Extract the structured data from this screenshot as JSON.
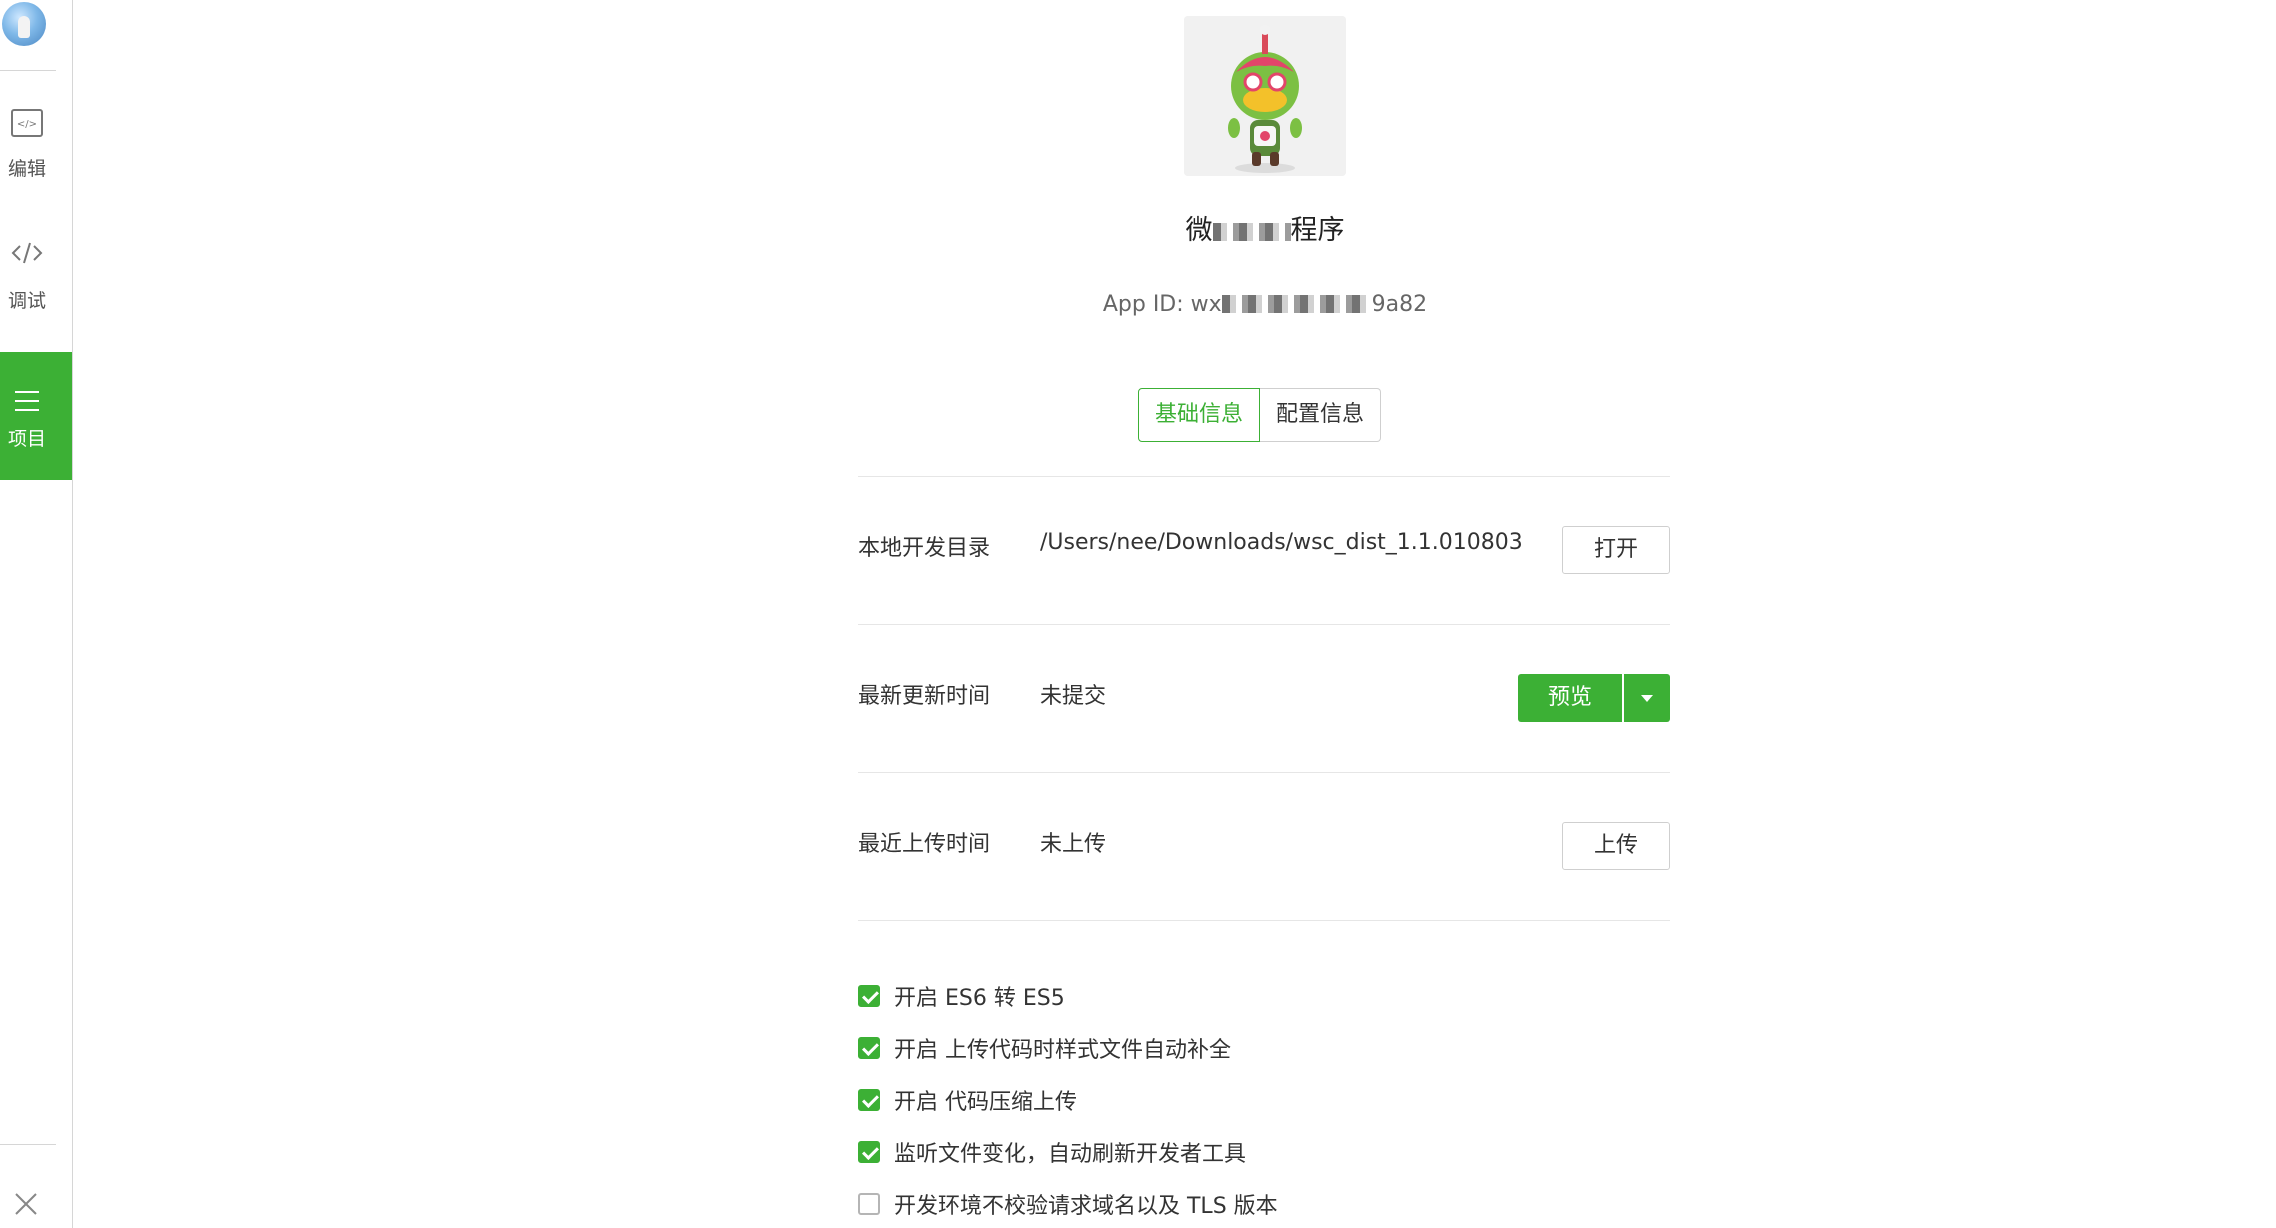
{
  "sidebar": {
    "nav": [
      {
        "label": "编辑",
        "icon": "editor-icon"
      },
      {
        "label": "调试",
        "icon": "code-icon"
      },
      {
        "label": "项目",
        "icon": "menu-icon"
      }
    ],
    "active": "项目",
    "close_label": "关闭"
  },
  "project": {
    "name_prefix": "微",
    "name_suffix": "程序",
    "app_id_prefix": "App ID: wx",
    "app_id_suffix": "9a82"
  },
  "tabs": [
    {
      "label": "基础信息",
      "active": true
    },
    {
      "label": "配置信息",
      "active": false
    }
  ],
  "rows": {
    "local_dir": {
      "label": "本地开发目录",
      "value": "/Users/nee/Downloads/wsc_dist_1.1.010803",
      "button": "打开"
    },
    "latest_update": {
      "label": "最新更新时间",
      "value": "未提交",
      "button": "预览"
    },
    "latest_upload": {
      "label": "最近上传时间",
      "value": "未上传",
      "button": "上传"
    }
  },
  "options": [
    {
      "label": "开启 ES6 转 ES5",
      "checked": true
    },
    {
      "label": "开启 上传代码时样式文件自动补全",
      "checked": true
    },
    {
      "label": "开启 代码压缩上传",
      "checked": true
    },
    {
      "label": "监听文件变化，自动刷新开发者工具",
      "checked": true
    },
    {
      "label": "开发环境不校验请求域名以及 TLS 版本",
      "checked": false
    }
  ],
  "colors": {
    "accent": "#3cb035",
    "border": "#cfcfcf",
    "text": "#333333"
  }
}
